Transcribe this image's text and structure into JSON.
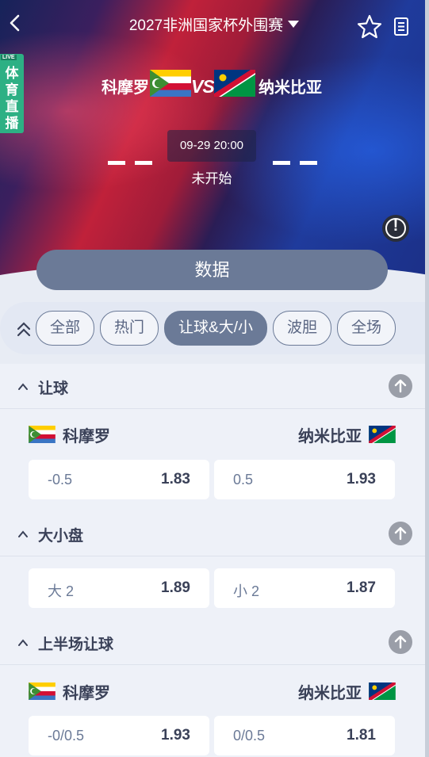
{
  "header": {
    "title": "2027非洲国家杯外围赛",
    "back_icon": "chevron-left-icon",
    "favorite_icon": "star-icon",
    "notes_icon": "document-icon"
  },
  "live_badge": {
    "tag": "LIVE",
    "text": "体育直播"
  },
  "match": {
    "home_team": "科摩罗",
    "away_team": "纳米比亚",
    "vs": "VS",
    "kickoff": "09-29 20:00",
    "status": "未开始",
    "home_score": "– –",
    "away_score": "– –"
  },
  "data_button": "数据",
  "tabs": [
    "全部",
    "热门",
    "让球&大/小",
    "波胆",
    "全场"
  ],
  "active_tab": "让球&大/小",
  "sections": {
    "handicap": {
      "title": "让球",
      "home_team": "科摩罗",
      "away_team": "纳米比亚",
      "odds": [
        {
          "line": "-0.5",
          "price": "1.83"
        },
        {
          "line": "0.5",
          "price": "1.93"
        }
      ]
    },
    "total": {
      "title": "大小盘",
      "odds": [
        {
          "line": "大 2",
          "price": "1.89"
        },
        {
          "line": "小 2",
          "price": "1.87"
        }
      ]
    },
    "first_half_handicap": {
      "title": "上半场让球",
      "home_team": "科摩罗",
      "away_team": "纳米比亚",
      "odds": [
        {
          "line": "-0/0.5",
          "price": "1.93"
        },
        {
          "line": "0/0.5",
          "price": "1.81"
        }
      ]
    }
  },
  "colors": {
    "accent": "#6b7a97",
    "live_green": "#2db084",
    "text_dark": "#3a4158"
  }
}
